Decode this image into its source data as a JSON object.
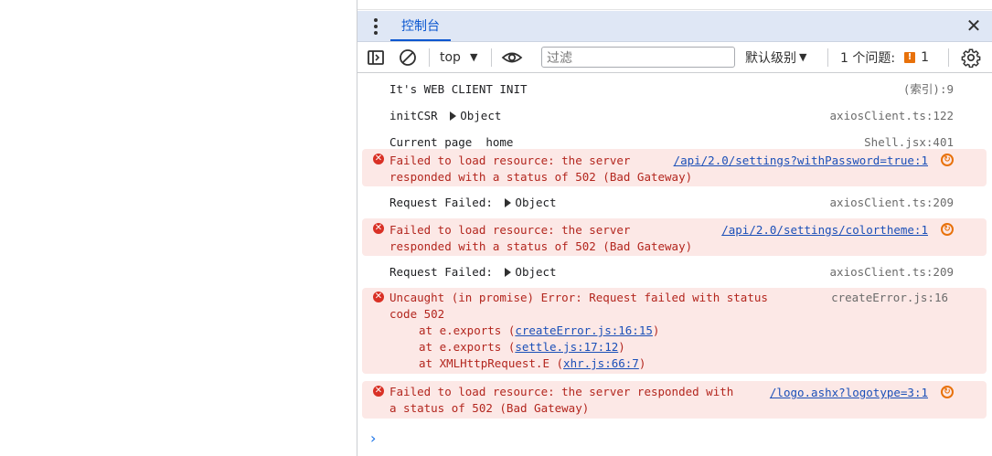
{
  "drawer": {
    "tab_label": "控制台"
  },
  "toolbar": {
    "context": "top",
    "filter_placeholder": "过滤",
    "levels": "默认级别",
    "issues_label": "1 个问题:",
    "issues_count": "1"
  },
  "messages": [
    {
      "kind": "log",
      "text": "It's WEB CLIENT INIT",
      "source": "(索引):9"
    },
    {
      "kind": "log",
      "text": "initCSR",
      "object": "Object",
      "source": "axiosClient.ts:122"
    },
    {
      "kind": "log",
      "text": "Current page  home",
      "source": "Shell.jsx:401"
    },
    {
      "kind": "error",
      "lines": [
        "Failed to load resource: the server",
        "responded with a status of 502 (Bad Gateway)"
      ],
      "source": "/api/2.0/settings?withPassword=true:1"
    },
    {
      "kind": "log",
      "text": "Request Failed:",
      "object": "Object",
      "source": "axiosClient.ts:209"
    },
    {
      "kind": "error",
      "lines": [
        "Failed to load resource: the server",
        "responded with a status of 502 (Bad Gateway)"
      ],
      "source": "/api/2.0/settings/colortheme:1"
    },
    {
      "kind": "log",
      "text": "Request Failed:",
      "object": "Object",
      "source": "axiosClient.ts:209"
    },
    {
      "kind": "exception",
      "lines": [
        "Uncaught (in promise) Error: Request failed with status",
        "code 502"
      ],
      "stack": [
        {
          "prefix": "at e.exports (",
          "link": "createError.js:16:15",
          "suffix": ")"
        },
        {
          "prefix": "at e.exports (",
          "link": "settle.js:17:12",
          "suffix": ")"
        },
        {
          "prefix": "at XMLHttpRequest.E (",
          "link": "xhr.js:66:7",
          "suffix": ")"
        }
      ],
      "source": "createError.js:16"
    },
    {
      "kind": "error",
      "lines": [
        "Failed to load resource: the server responded with",
        "a status of 502 (Bad Gateway)"
      ],
      "source": "/logo.ashx?logotype=3:1"
    }
  ]
}
